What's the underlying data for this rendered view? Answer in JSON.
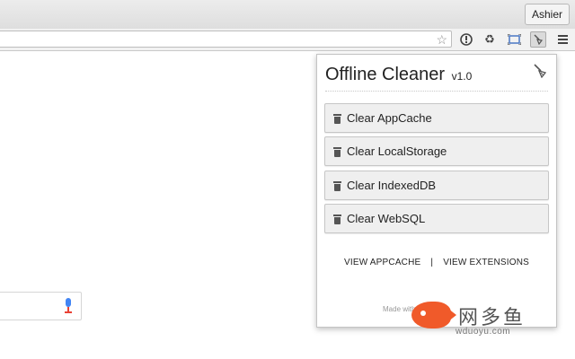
{
  "browser": {
    "profile_name": "Ashier",
    "icons": [
      "star-icon",
      "info-icon",
      "recycle-icon",
      "screen-icon",
      "broom-extension-icon",
      "menu-icon"
    ]
  },
  "popup": {
    "title": "Offline Cleaner",
    "version": "v1.0",
    "buttons": [
      {
        "label": "Clear AppCache"
      },
      {
        "label": "Clear LocalStorage"
      },
      {
        "label": "Clear IndexedDB"
      },
      {
        "label": "Clear WebSQL"
      }
    ],
    "links": {
      "view_appcache": "VIEW APPCACHE",
      "separator": "|",
      "view_extensions": "VIEW EXTENSIONS"
    },
    "footer": "Made with"
  },
  "watermark": {
    "brand": "网多鱼",
    "url": "wduoyu.com"
  },
  "colors": {
    "watermark_orange": "#f05a2a",
    "mic_blue": "#4285f4",
    "mic_red": "#e94235"
  }
}
